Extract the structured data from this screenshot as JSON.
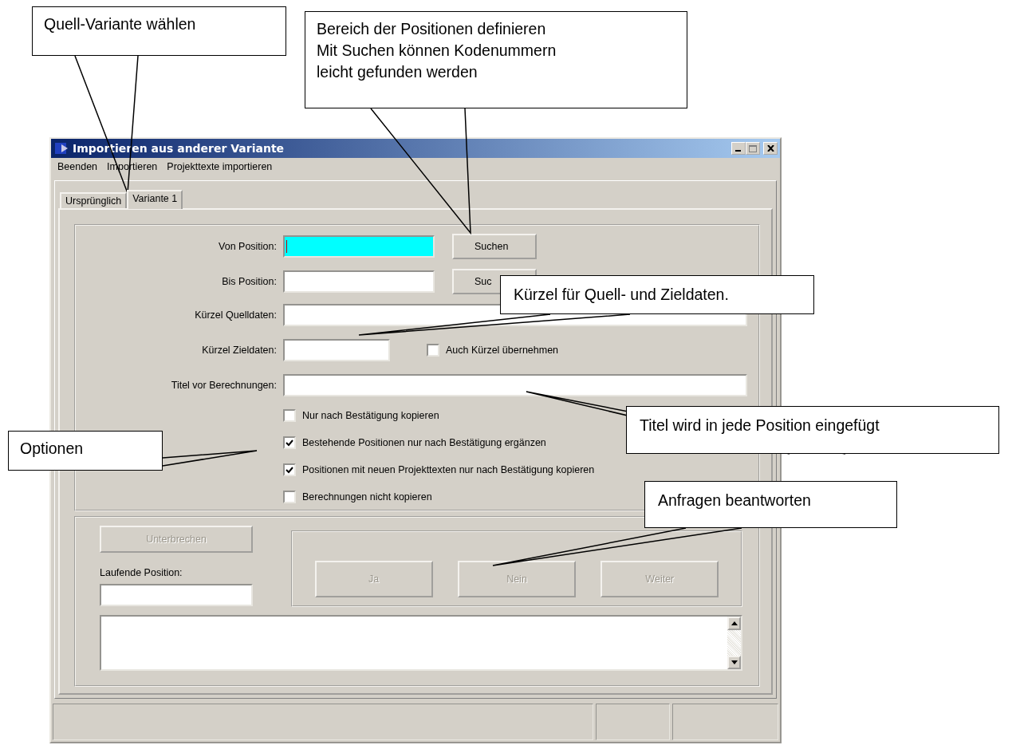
{
  "window": {
    "title": "Importieren aus anderer Variante"
  },
  "menu": [
    {
      "label": "Beenden"
    },
    {
      "label": "Importieren"
    },
    {
      "label": "Projekttexte importieren"
    }
  ],
  "tabs": [
    {
      "label": "Ursprünglich",
      "selected": false
    },
    {
      "label": "Variante 1",
      "selected": true
    }
  ],
  "rows": [
    {
      "kind": "search",
      "label": "Von Position:",
      "highlighted": true,
      "button": "Suchen"
    },
    {
      "kind": "search",
      "label": "Bis Position:",
      "highlighted": false,
      "button": "Suc"
    },
    {
      "kind": "wide",
      "label": "Kürzel Quelldaten:",
      "highlighted": false
    },
    {
      "kind": "short",
      "label": "Kürzel Zieldaten:",
      "highlighted": false,
      "checkbox": {
        "label": "Auch Kürzel übernehmen",
        "checked": false
      }
    },
    {
      "kind": "wide",
      "label": "Titel vor Berechnungen:",
      "highlighted": false
    }
  ],
  "options": [
    {
      "label": "Nur nach Bestätigung kopieren",
      "checked": false
    },
    {
      "label": "Bestehende Positionen nur nach Bestätigung ergänzen",
      "checked": true
    },
    {
      "label": "Positionen mit neuen Projekttexten nur nach Bestätigung kopieren",
      "checked": true
    },
    {
      "label": "Berechnungen nicht kopieren",
      "checked": false
    }
  ],
  "progress": {
    "interrupt_button": {
      "label": "Unterbrechen",
      "disabled": true
    },
    "current_label": "Laufende Position:",
    "answer_buttons": [
      {
        "label": "Ja",
        "disabled": true
      },
      {
        "label": "Nein",
        "disabled": true
      },
      {
        "label": "Weiter",
        "disabled": true
      }
    ]
  },
  "callouts": [
    {
      "lines": [
        "Quell-Variante wählen"
      ]
    },
    {
      "lines": [
        "Bereich der Positionen definieren",
        "Mit Suchen können Kodenummern",
        "leicht gefunden werden"
      ]
    },
    {
      "lines": [
        "Kürzel für Quell- und Zieldaten."
      ]
    },
    {
      "lines": [
        "Titel wird in jede Position eingefügt"
      ]
    },
    {
      "lines": [
        "Optionen"
      ]
    },
    {
      "lines": [
        "Anfragen beantworten"
      ]
    }
  ]
}
